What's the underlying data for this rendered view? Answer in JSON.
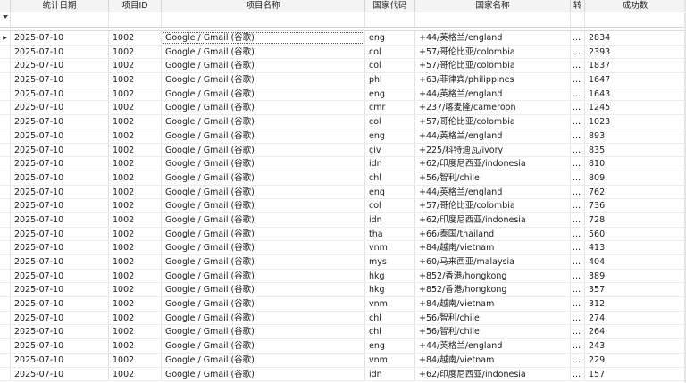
{
  "columns": [
    "统计日期",
    "项目ID",
    "项目名称",
    "国家代码",
    "国家名称",
    "转",
    "成功数"
  ],
  "row_indicator": "▶",
  "rows": [
    [
      "2025-07-10",
      "1002",
      "Google / Gmail (谷歌)",
      "eng",
      "+44/英格兰/england",
      "...",
      "2834"
    ],
    [
      "2025-07-10",
      "1002",
      "Google / Gmail (谷歌)",
      "col",
      "+57/哥伦比亚/colombia",
      "...",
      "2393"
    ],
    [
      "2025-07-10",
      "1002",
      "Google / Gmail (谷歌)",
      "col",
      "+57/哥伦比亚/colombia",
      "...",
      "1837"
    ],
    [
      "2025-07-10",
      "1002",
      "Google / Gmail (谷歌)",
      "phl",
      "+63/菲律宾/philippines",
      "...",
      "1647"
    ],
    [
      "2025-07-10",
      "1002",
      "Google / Gmail (谷歌)",
      "eng",
      "+44/英格兰/england",
      "...",
      "1643"
    ],
    [
      "2025-07-10",
      "1002",
      "Google / Gmail (谷歌)",
      "cmr",
      "+237/喀麦隆/cameroon",
      "...",
      "1245"
    ],
    [
      "2025-07-10",
      "1002",
      "Google / Gmail (谷歌)",
      "col",
      "+57/哥伦比亚/colombia",
      "...",
      "1023"
    ],
    [
      "2025-07-10",
      "1002",
      "Google / Gmail (谷歌)",
      "eng",
      "+44/英格兰/england",
      "...",
      "893"
    ],
    [
      "2025-07-10",
      "1002",
      "Google / Gmail (谷歌)",
      "civ",
      "+225/科特迪瓦/ivory",
      "...",
      "835"
    ],
    [
      "2025-07-10",
      "1002",
      "Google / Gmail (谷歌)",
      "idn",
      "+62/印度尼西亚/indonesia",
      "...",
      "810"
    ],
    [
      "2025-07-10",
      "1002",
      "Google / Gmail (谷歌)",
      "chl",
      "+56/智利/chile",
      "...",
      "809"
    ],
    [
      "2025-07-10",
      "1002",
      "Google / Gmail (谷歌)",
      "eng",
      "+44/英格兰/england",
      "...",
      "762"
    ],
    [
      "2025-07-10",
      "1002",
      "Google / Gmail (谷歌)",
      "col",
      "+57/哥伦比亚/colombia",
      "...",
      "736"
    ],
    [
      "2025-07-10",
      "1002",
      "Google / Gmail (谷歌)",
      "idn",
      "+62/印度尼西亚/indonesia",
      "...",
      "728"
    ],
    [
      "2025-07-10",
      "1002",
      "Google / Gmail (谷歌)",
      "tha",
      "+66/泰国/thailand",
      "...",
      "560"
    ],
    [
      "2025-07-10",
      "1002",
      "Google / Gmail (谷歌)",
      "vnm",
      "+84/越南/vietnam",
      "...",
      "413"
    ],
    [
      "2025-07-10",
      "1002",
      "Google / Gmail (谷歌)",
      "mys",
      "+60/马来西亚/malaysia",
      "...",
      "404"
    ],
    [
      "2025-07-10",
      "1002",
      "Google / Gmail (谷歌)",
      "hkg",
      "+852/香港/hongkong",
      "...",
      "389"
    ],
    [
      "2025-07-10",
      "1002",
      "Google / Gmail (谷歌)",
      "hkg",
      "+852/香港/hongkong",
      "...",
      "357"
    ],
    [
      "2025-07-10",
      "1002",
      "Google / Gmail (谷歌)",
      "vnm",
      "+84/越南/vietnam",
      "...",
      "312"
    ],
    [
      "2025-07-10",
      "1002",
      "Google / Gmail (谷歌)",
      "chl",
      "+56/智利/chile",
      "...",
      "274"
    ],
    [
      "2025-07-10",
      "1002",
      "Google / Gmail (谷歌)",
      "chl",
      "+56/智利/chile",
      "...",
      "264"
    ],
    [
      "2025-07-10",
      "1002",
      "Google / Gmail (谷歌)",
      "eng",
      "+44/英格兰/england",
      "...",
      "243"
    ],
    [
      "2025-07-10",
      "1002",
      "Google / Gmail (谷歌)",
      "vnm",
      "+84/越南/vietnam",
      "...",
      "229"
    ],
    [
      "2025-07-10",
      "1002",
      "Google / Gmail (谷歌)",
      "idn",
      "+62/印度尼西亚/indonesia",
      "...",
      "157"
    ]
  ],
  "icons": {
    "filter_row": "funnel-icon",
    "current_row": "row-indicator-icon"
  }
}
